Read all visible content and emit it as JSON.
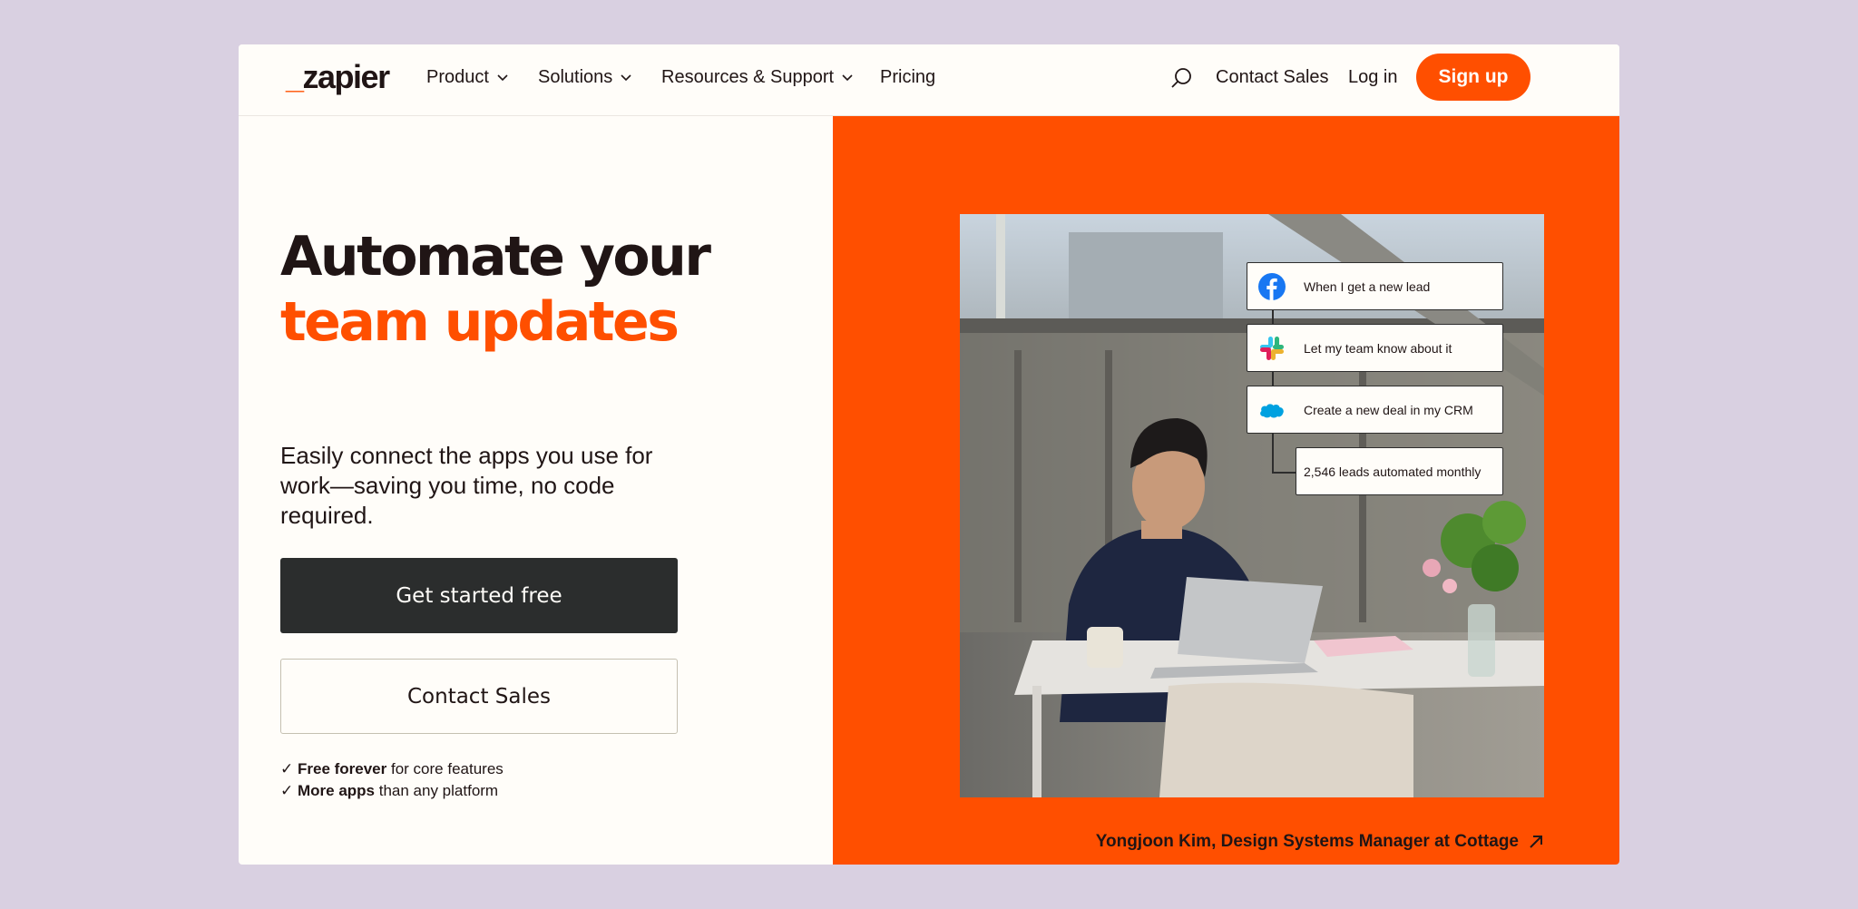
{
  "brand": {
    "logo_text": "zapier",
    "logo_dash": "_",
    "accent": "#ff4f00"
  },
  "nav": {
    "items": [
      {
        "label": "Product",
        "has_dropdown": true
      },
      {
        "label": "Solutions",
        "has_dropdown": true
      },
      {
        "label": "Resources & Support",
        "has_dropdown": true
      },
      {
        "label": "Pricing",
        "has_dropdown": false
      }
    ],
    "search_icon": "search-icon",
    "contact_sales": "Contact Sales",
    "log_in": "Log in",
    "sign_up": "Sign up"
  },
  "hero": {
    "title_line1": "Automate your",
    "title_line2": "team updates",
    "subtitle": "Easily connect the apps you use for work—saving you time, no code required.",
    "primary_cta": "Get started free",
    "secondary_cta": "Contact Sales",
    "features": [
      {
        "check": "✓",
        "bold": "Free forever",
        "rest": " for core features"
      },
      {
        "check": "✓",
        "bold": "More apps",
        "rest": " than any platform"
      }
    ]
  },
  "workflow": {
    "steps": [
      {
        "icon": "facebook-icon",
        "text": "When I get a new lead"
      },
      {
        "icon": "slack-icon",
        "text": "Let my team know about it"
      },
      {
        "icon": "salesforce-icon",
        "text": "Create a new deal in my CRM"
      }
    ],
    "stat": "2,546 leads automated monthly"
  },
  "caption": {
    "text": "Yongjoon Kim, Design Systems Manager at Cottage",
    "icon": "arrow-up-right-icon"
  }
}
